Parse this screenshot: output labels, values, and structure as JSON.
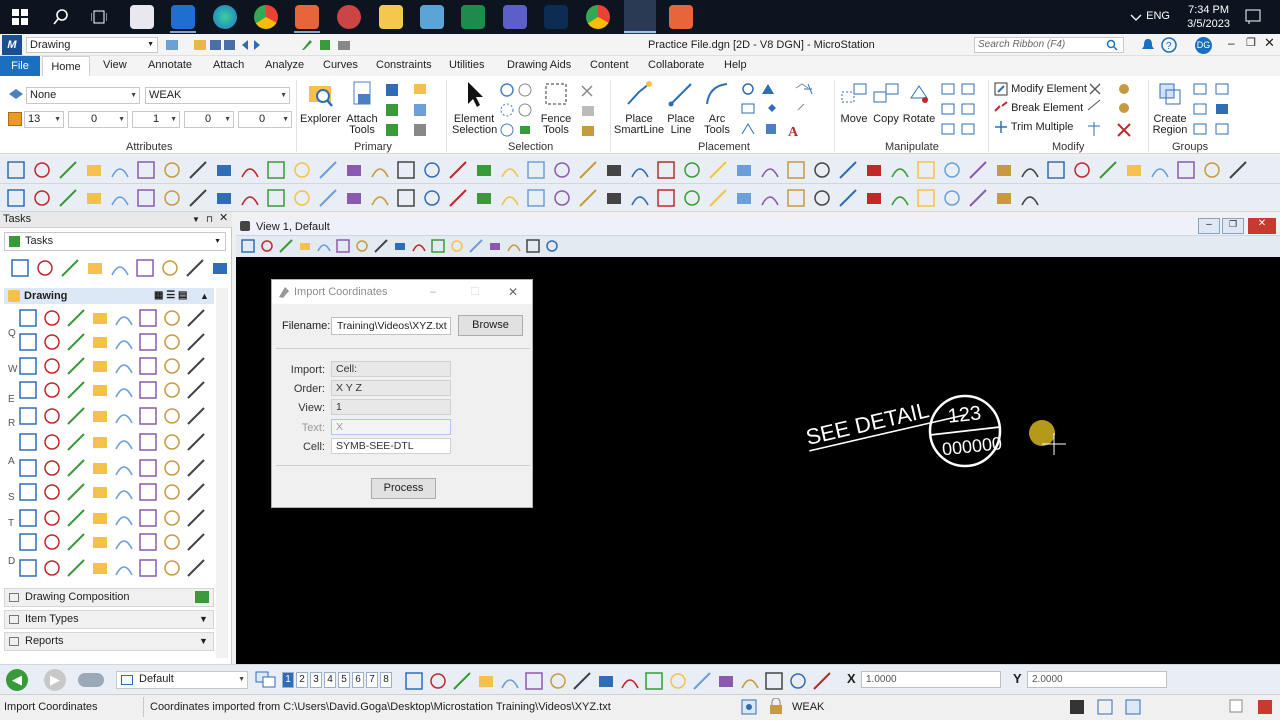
{
  "taskbar": {
    "clock_time": "7:34 PM",
    "clock_date": "3/5/2023",
    "language": "ENG"
  },
  "titlebar": {
    "workspace": "Drawing",
    "window_title": "Practice File.dgn [2D - V8 DGN] - MicroStation",
    "search_placeholder": "Search Ribbon (F4)",
    "user_initials": "DG"
  },
  "ribbon_tabs": [
    "File",
    "Home",
    "View",
    "Annotate",
    "Attach",
    "Analyze",
    "Curves",
    "Constraints",
    "Utilities",
    "Drawing Aids",
    "Content",
    "Collaborate",
    "Help"
  ],
  "attributes": {
    "level": "None",
    "text_style": "WEAK",
    "color": "13",
    "line_style": "0",
    "weight": "1",
    "transparency": "0",
    "priority": "0",
    "group_label": "Attributes"
  },
  "primary": {
    "explorer": "Explorer",
    "attach_tools_1": "Attach",
    "attach_tools_2": "Tools",
    "group_label": "Primary"
  },
  "selection": {
    "element_selection_1": "Element",
    "element_selection_2": "Selection",
    "fence_tools_1": "Fence",
    "fence_tools_2": "Tools",
    "group_label": "Selection"
  },
  "placement": {
    "smartline_1": "Place",
    "smartline_2": "SmartLine",
    "line_1": "Place",
    "line_2": "Line",
    "arc_1": "Arc",
    "arc_2": "Tools",
    "group_label": "Placement"
  },
  "manipulate": {
    "move": "Move",
    "copy": "Copy",
    "rotate": "Rotate",
    "group_label": "Manipulate"
  },
  "modify": {
    "modify_element": "Modify Element",
    "break_element": "Break Element",
    "trim_multiple": "Trim Multiple",
    "group_label": "Modify"
  },
  "groups": {
    "create_region_1": "Create",
    "create_region_2": "Region",
    "group_label": "Groups"
  },
  "tasks_panel": {
    "header": "Tasks",
    "combo": "Tasks",
    "drawing_section": "Drawing",
    "side_letters": [
      "Q",
      "W",
      "E",
      "R",
      "A",
      "S",
      "T",
      "D"
    ],
    "accordion": [
      "Drawing Composition",
      "Item Types",
      "Reports"
    ]
  },
  "view": {
    "title": "View 1, Default"
  },
  "dialog": {
    "title": "Import Coordinates",
    "filename_label": "Filename:",
    "filename_value": "Training\\Videos\\XYZ.txt",
    "browse": "Browse",
    "import_label": "Import:",
    "import_value": "Cell:",
    "order_label": "Order:",
    "order_value": "X Y Z",
    "view_label": "View:",
    "view_value": "1",
    "text_label": "Text:",
    "text_value": "X",
    "cell_label": "Cell:",
    "cell_value": "SYMB-SEE-DTL",
    "process": "Process"
  },
  "drawing": {
    "see_detail": "SEE DETAIL",
    "circle_top": "123",
    "circle_bottom": "000000"
  },
  "bottom": {
    "model": "Default",
    "view_numbers": [
      "1",
      "2",
      "3",
      "4",
      "5",
      "6",
      "7",
      "8"
    ],
    "x_label": "X",
    "x_value": "1.0000",
    "y_label": "Y",
    "y_value": "2.0000"
  },
  "status": {
    "tool": "Import Coordinates",
    "message": "Coordinates imported from C:\\Users\\David.Goga\\Desktop\\Microstation Training\\Videos\\XYZ.txt",
    "style": "WEAK"
  },
  "colors": {
    "accent": "#1a6fbf",
    "canvas": "#000000",
    "drawing_marker": "#b59a1a"
  }
}
